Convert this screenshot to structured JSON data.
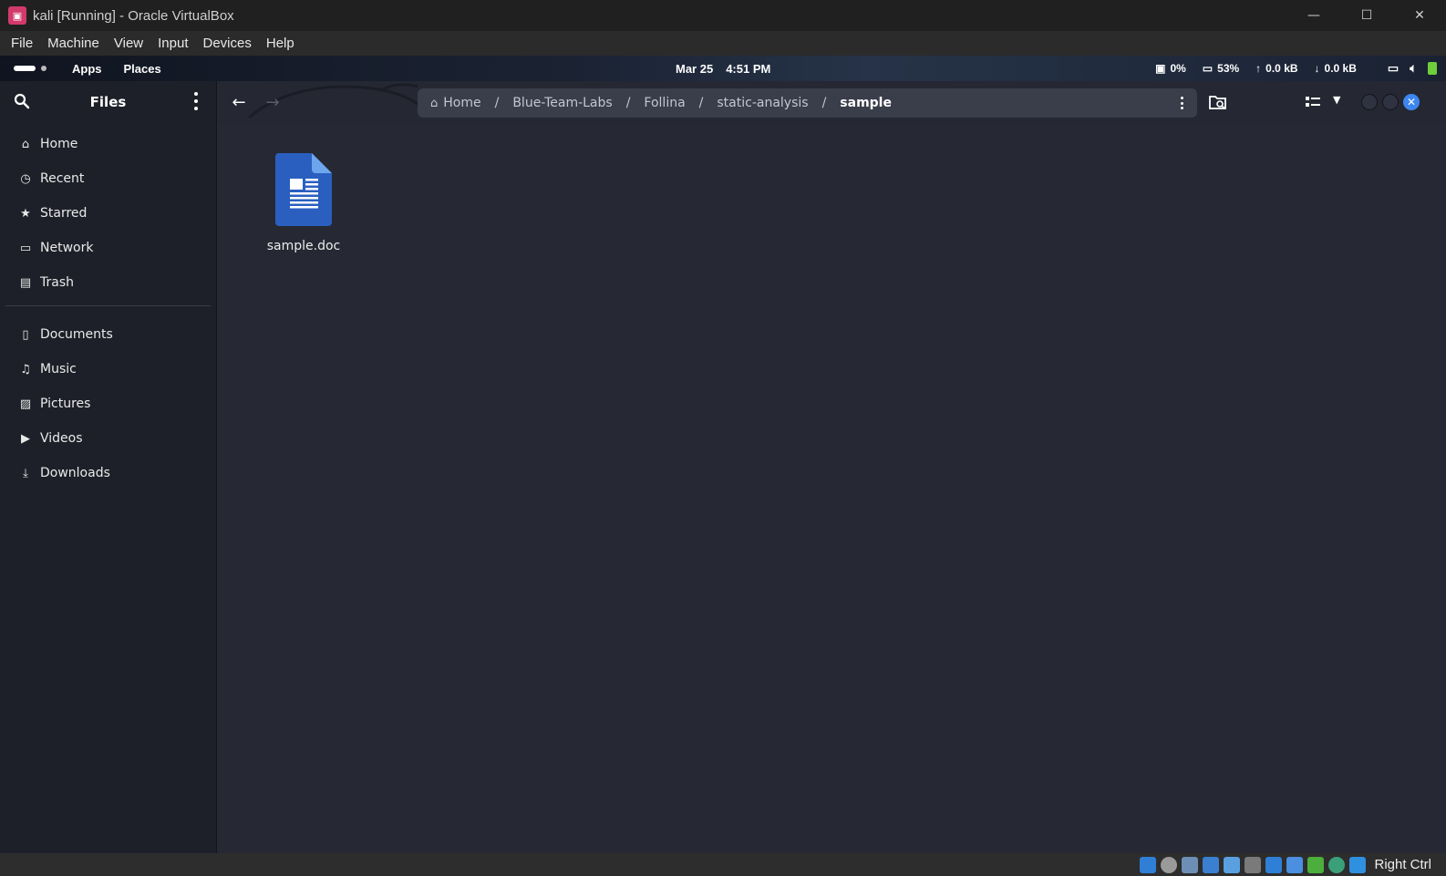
{
  "host": {
    "title": "kali [Running] - Oracle VirtualBox",
    "menu": [
      "File",
      "Machine",
      "View",
      "Input",
      "Devices",
      "Help"
    ],
    "controls": {
      "minimize": "—",
      "maximize": "☐",
      "close": "✕"
    }
  },
  "panel": {
    "apps": "Apps",
    "places": "Places",
    "date": "Mar 25",
    "time": "4:51 PM",
    "cpu": "0%",
    "memory": "53%",
    "upload": "0.0 kB",
    "download": "0.0 kB"
  },
  "sidebar": {
    "title": "Files",
    "items": [
      {
        "label": "Home",
        "icon": "home-icon"
      },
      {
        "label": "Recent",
        "icon": "clock-icon"
      },
      {
        "label": "Starred",
        "icon": "star-icon"
      },
      {
        "label": "Network",
        "icon": "network-icon"
      },
      {
        "label": "Trash",
        "icon": "trash-icon"
      }
    ],
    "bookmarks": [
      {
        "label": "Documents",
        "icon": "document-icon"
      },
      {
        "label": "Music",
        "icon": "music-icon"
      },
      {
        "label": "Pictures",
        "icon": "pictures-icon"
      },
      {
        "label": "Videos",
        "icon": "video-icon"
      },
      {
        "label": "Downloads",
        "icon": "download-icon"
      }
    ]
  },
  "pathbar": {
    "crumbs": [
      "Home",
      "Blue-Team-Labs",
      "Follina",
      "static-analysis"
    ],
    "current": "sample",
    "separator": "/"
  },
  "files": [
    {
      "name": "sample.doc",
      "icon": "word-document-icon"
    }
  ],
  "statusbar": {
    "host_key": "Right Ctrl"
  },
  "colors": {
    "accent": "#3d86f0",
    "doc_icon": "#2a5fbf",
    "battery": "#6fcf3a"
  }
}
